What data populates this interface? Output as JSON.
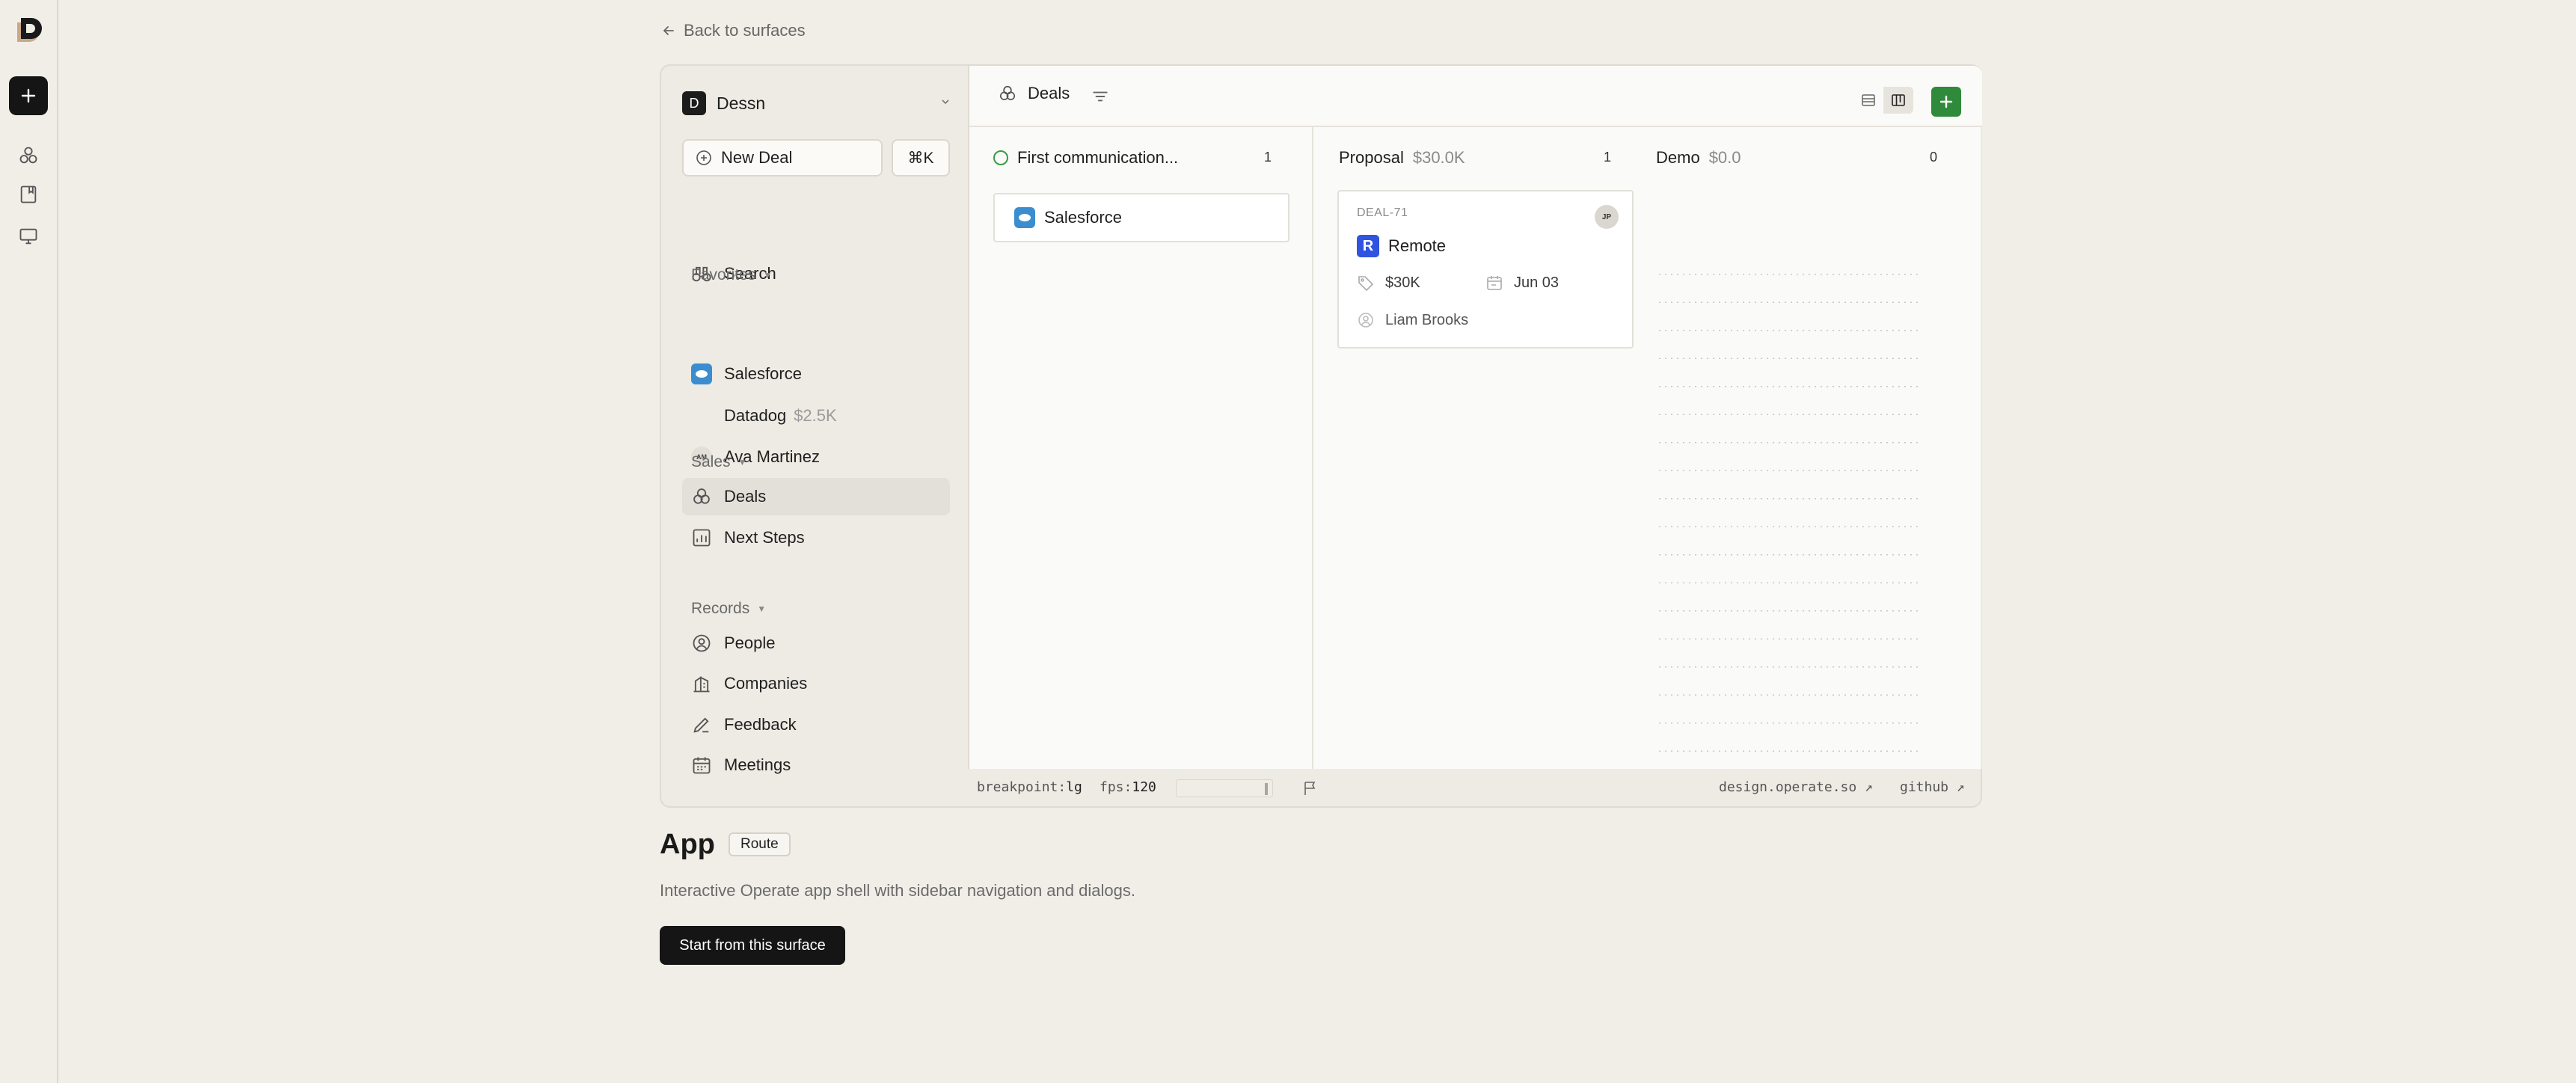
{
  "back_link": "Back to surfaces",
  "sidebar": {
    "workspace": {
      "initial": "D",
      "name": "Dessn"
    },
    "new_deal": "New Deal",
    "shortcut": "⌘K",
    "search": "Search",
    "favorites": {
      "label": "Favorites",
      "items": [
        {
          "label": "Salesforce",
          "value": ""
        },
        {
          "label": "Datadog",
          "value": "$2.5K"
        },
        {
          "label": "Ava Martinez",
          "initials": "AM"
        }
      ]
    },
    "sales": {
      "label": "Sales",
      "items": [
        "Deals",
        "Next Steps"
      ]
    },
    "records": {
      "label": "Records",
      "items": [
        "People",
        "Companies",
        "Feedback",
        "Meetings"
      ]
    }
  },
  "topbar": {
    "title": "Deals"
  },
  "columns": [
    {
      "name": "First communication...",
      "amount": "",
      "count": "1"
    },
    {
      "name": "Proposal",
      "amount": "$30.0K",
      "count": "1"
    },
    {
      "name": "Demo",
      "amount": "$0.0",
      "count": "0"
    }
  ],
  "cards": {
    "first": {
      "company": "Salesforce"
    },
    "proposal": {
      "id": "DEAL-71",
      "owner_initials": "JP",
      "company": "Remote",
      "company_initial": "R",
      "value": "$30K",
      "date": "Jun 03",
      "person": "Liam Brooks"
    }
  },
  "status": {
    "breakpoint_key": "breakpoint:",
    "breakpoint_val": "lg",
    "fps_key": "fps:",
    "fps_val": "120",
    "design_link": "design.operate.so ↗",
    "github_link": "github ↗"
  },
  "surface": {
    "title": "App",
    "badge": "Route",
    "description": "Interactive Operate app shell with sidebar navigation and dialogs.",
    "cta": "Start from this surface"
  },
  "colors": {
    "accent_green": "#2f8a3b",
    "salesforce_blue": "#3b8dd0",
    "remote_blue": "#2f54e0"
  }
}
